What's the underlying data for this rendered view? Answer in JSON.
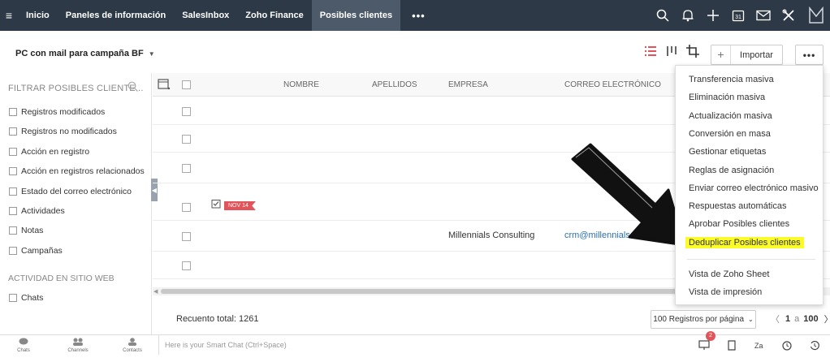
{
  "nav": {
    "items": [
      {
        "label": "Inicio",
        "active": false
      },
      {
        "label": "Paneles de información",
        "active": false
      },
      {
        "label": "SalesInbox",
        "active": false
      },
      {
        "label": "Zoho Finance",
        "active": false
      },
      {
        "label": "Posibles clientes",
        "active": true
      }
    ],
    "more_label": "•••",
    "right_icons": [
      "search-icon",
      "bell-icon",
      "plus-icon",
      "calendar-icon",
      "mail-icon",
      "tools-icon",
      "avatar"
    ]
  },
  "header": {
    "view_name": "PC con mail para campaña BF",
    "import_label": "Importar",
    "more_label": "•••"
  },
  "sidebar": {
    "filter_title": "FILTRAR POSIBLES CLIENTE...",
    "filters": [
      "Registros modificados",
      "Registros no modificados",
      "Acción en registro",
      "Acción en registros relacionados",
      "Estado del correo electrónico",
      "Actividades",
      "Notas",
      "Campañas"
    ],
    "section_title": "ACTIVIDAD EN SITIO WEB",
    "section_items": [
      "Chats"
    ]
  },
  "table": {
    "columns": [
      "NOMBRE",
      "APELLIDOS",
      "EMPRESA",
      "CORREO ELECTRÓNICO"
    ],
    "rows": [
      {
        "tag": "",
        "empresa": "",
        "correo": ""
      },
      {
        "tag": "",
        "empresa": "",
        "correo": ""
      },
      {
        "tag": "",
        "empresa": "",
        "correo": ""
      },
      {
        "tag": "NOV 14",
        "empresa": "",
        "correo": ""
      },
      {
        "tag": "",
        "empresa": "Millennials Consulting",
        "correo": "crm@millennials"
      },
      {
        "tag": "",
        "empresa": "",
        "correo": ""
      }
    ]
  },
  "footer": {
    "total": "Recuento total: 1261",
    "per_page": "100 Registros por página",
    "page_from": "1",
    "page_sep": "a",
    "page_to": "100"
  },
  "menu": {
    "items": [
      "Transferencia masiva",
      "Eliminación masiva",
      "Actualización masiva",
      "Conversión en masa",
      "Gestionar etiquetas",
      "Reglas de asignación",
      "Enviar correo electrónico masivo",
      "Respuestas automáticas",
      "Aprobar Posibles clientes",
      "Deduplicar Posibles clientes"
    ],
    "highlighted": "Deduplicar Posibles clientes",
    "items2": [
      "Vista de Zoho Sheet",
      "Vista de impresión"
    ]
  },
  "chatbar": {
    "buttons": [
      "Chats",
      "Channels",
      "Contacts"
    ],
    "placeholder": "Here is your Smart Chat (Ctrl+Space)",
    "badge": "2"
  },
  "colors": {
    "nav_bg": "#2e3947",
    "nav_active": "#4d5a6a",
    "tag": "#e2545a",
    "highlight": "#fbfb2a",
    "link": "#2a6fb4"
  }
}
